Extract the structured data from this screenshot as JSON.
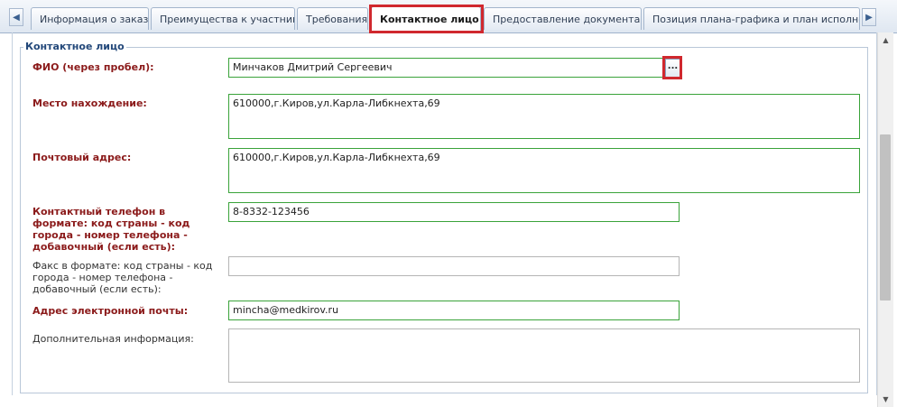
{
  "tabs": [
    {
      "label": "Информация о заказе"
    },
    {
      "label": "Преимущества к участникам"
    },
    {
      "label": "Требования"
    },
    {
      "label": "Контактное лицо"
    },
    {
      "label": "Предоставление документации"
    },
    {
      "label": "Позиция плана-графика и план исполнения ко"
    }
  ],
  "nav": {
    "left_glyph": "◀",
    "right_glyph": "▶"
  },
  "section": {
    "title": "Контактное лицо"
  },
  "form": {
    "fio": {
      "label": "ФИО (через пробел):",
      "value": "Минчаков Дмитрий Сергеевич",
      "button": "..."
    },
    "location": {
      "label": "Место нахождение:",
      "value": "610000,г.Киров,ул.Карла-Либкнехта,69"
    },
    "postal": {
      "label": "Почтовый адрес:",
      "value": "610000,г.Киров,ул.Карла-Либкнехта,69"
    },
    "phone": {
      "label": "Контактный телефон в формате: код страны - код города - номер телефона - добавочный (если есть):",
      "value": "8-8332-123456"
    },
    "fax": {
      "label": "Факс в формате: код страны - код города - номер телефона - добавочный (если есть):",
      "value": ""
    },
    "email": {
      "label": "Адрес электронной почты:",
      "value": "mincha@medkirov.ru"
    },
    "extra": {
      "label": "Дополнительная информация:",
      "value": ""
    }
  },
  "scrollbar": {
    "up": "▲",
    "down": "▼"
  },
  "colors": {
    "highlight": "#d0282e",
    "required_label": "#8b1a1a",
    "valid_border": "#3aa33a"
  }
}
